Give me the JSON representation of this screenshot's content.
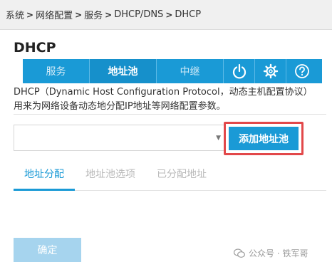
{
  "breadcrumb": {
    "items": [
      "系统",
      "网络配置",
      "服务",
      "DHCP/DNS",
      "DHCP"
    ],
    "separator": ">"
  },
  "page": {
    "title": "DHCP"
  },
  "tabs": [
    {
      "label": "服务",
      "active": false
    },
    {
      "label": "地址池",
      "active": true
    },
    {
      "label": "中继",
      "active": false
    }
  ],
  "tab_icons": [
    "power-icon",
    "gear-icon",
    "help-icon"
  ],
  "description": "DHCP（Dynamic Host Configuration Protocol，动态主机配置协议）用来为网络设备动态地分配IP地址等网络配置参数。",
  "pool_select": {
    "value": "",
    "caret": "▼"
  },
  "add_pool_button": {
    "label": "添加地址池"
  },
  "subtabs": [
    {
      "label": "地址分配",
      "active": true
    },
    {
      "label": "地址池选项",
      "active": false
    },
    {
      "label": "已分配地址",
      "active": false
    }
  ],
  "confirm_button": {
    "label": "确定"
  },
  "watermark": {
    "text": "公众号 · 铁军哥"
  },
  "colors": {
    "accent": "#1a9ad6",
    "highlight_border": "#e2484a",
    "disabled_button": "#a6d4ee"
  }
}
